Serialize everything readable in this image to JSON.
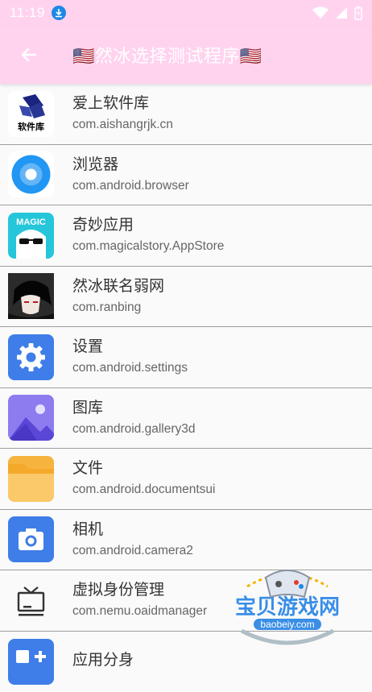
{
  "statusbar": {
    "time": "11:19"
  },
  "appbar": {
    "title": "🇺🇸然冰选择测试程序🇺🇸"
  },
  "apps": [
    {
      "name": "爱上软件库",
      "package": "com.aishangrjk.cn",
      "icon": "aishang-logo-icon",
      "icon_text": "软件库"
    },
    {
      "name": "浏览器",
      "package": "com.android.browser",
      "icon": "browser-icon"
    },
    {
      "name": "奇妙应用",
      "package": "com.magicalstory.AppStore",
      "icon": "magic-app-icon",
      "icon_text": "MAGIC"
    },
    {
      "name": "然冰联名弱网",
      "package": "com.ranbing",
      "icon": "anime-avatar-icon"
    },
    {
      "name": "设置",
      "package": "com.android.settings",
      "icon": "settings-gear-icon"
    },
    {
      "name": "图库",
      "package": "com.android.gallery3d",
      "icon": "gallery-icon"
    },
    {
      "name": "文件",
      "package": "com.android.documentsui",
      "icon": "folder-icon"
    },
    {
      "name": "相机",
      "package": "com.android.camera2",
      "icon": "camera-icon"
    },
    {
      "name": "虚拟身份管理",
      "package": "com.nemu.oaidmanager",
      "icon": "tv-icon"
    },
    {
      "name": "应用分身",
      "package": "",
      "icon": "app-clone-icon"
    }
  ],
  "watermark": {
    "text": "宝贝游戏网",
    "url": "baobeiy.com"
  },
  "colors": {
    "appbar": "#ffd3ee",
    "accent": "#1e88e5"
  }
}
